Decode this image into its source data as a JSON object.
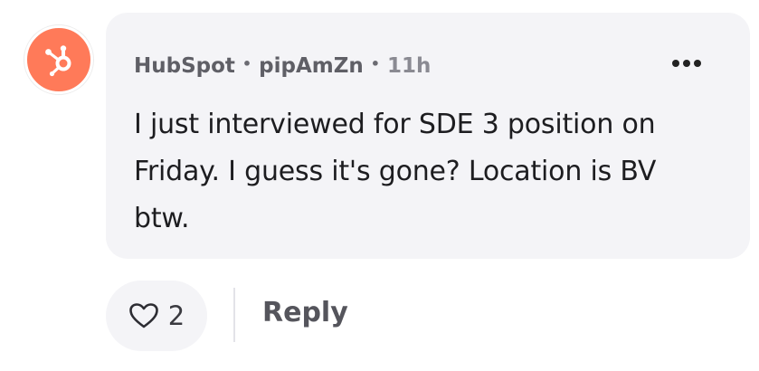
{
  "comment": {
    "company": "HubSpot",
    "username": "pipAmZn",
    "separator": "•",
    "time": "11h",
    "text": "I just interviewed for SDE 3 position on Friday. I guess it's gone? Location is BV btw.",
    "avatar_icon": "hubspot-logo-icon",
    "menu_icon": "more-options-icon"
  },
  "actions": {
    "like_icon": "heart-icon",
    "like_count": "2",
    "reply_label": "Reply"
  },
  "colors": {
    "avatar_bg": "#ff7a59",
    "bubble_bg": "#f4f4f7",
    "meta_text": "#5f5f66"
  }
}
